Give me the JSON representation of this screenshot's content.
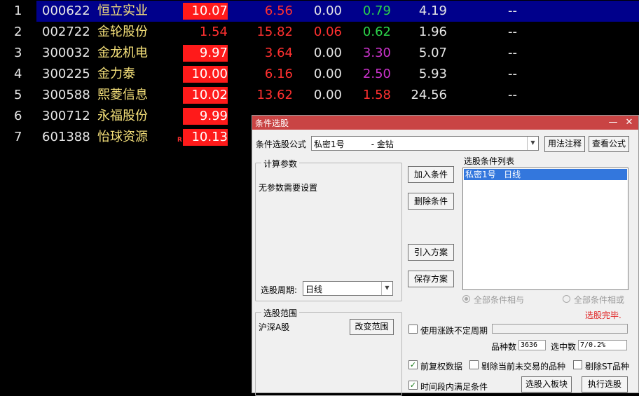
{
  "stocks": [
    {
      "idx": "1",
      "code": "000622",
      "name": "恒立实业",
      "pct": "10.07",
      "price": "6.56",
      "chg": "0.00",
      "turn": "0.79",
      "pe": "4.19",
      "extra": "--",
      "selected": true,
      "pct_red": true,
      "chg_red": false,
      "turn_color": "green"
    },
    {
      "idx": "2",
      "code": "002722",
      "name": "金轮股份",
      "pct": "1.54",
      "price": "15.82",
      "chg": "0.06",
      "turn": "0.62",
      "pe": "1.96",
      "extra": "--",
      "selected": false,
      "pct_red": false,
      "chg_red": true,
      "turn_color": "green"
    },
    {
      "idx": "3",
      "code": "300032",
      "name": "金龙机电",
      "pct": "9.97",
      "price": "3.64",
      "chg": "0.00",
      "turn": "3.30",
      "pe": "5.07",
      "extra": "--",
      "selected": false,
      "pct_red": true,
      "chg_red": false,
      "turn_color": "purple"
    },
    {
      "idx": "4",
      "code": "300225",
      "name": "金力泰",
      "pct": "10.00",
      "price": "6.16",
      "chg": "0.00",
      "turn": "2.50",
      "pe": "5.93",
      "extra": "--",
      "selected": false,
      "pct_red": true,
      "chg_red": false,
      "turn_color": "purple"
    },
    {
      "idx": "5",
      "code": "300588",
      "name": "熙菱信息",
      "pct": "10.02",
      "price": "13.62",
      "chg": "0.00",
      "turn": "1.58",
      "pe": "24.56",
      "extra": "--",
      "selected": false,
      "pct_red": true,
      "chg_red": false,
      "turn_color": "red"
    },
    {
      "idx": "6",
      "code": "300712",
      "name": "永福股份",
      "pct": "9.99",
      "price": "",
      "chg": "",
      "turn": "",
      "pe": "",
      "extra": "",
      "selected": false,
      "pct_red": true,
      "chg_red": false,
      "turn_color": "green"
    },
    {
      "idx": "7",
      "code": "601388",
      "name": "怡球资源",
      "pct": "10.13",
      "price": "",
      "chg": "",
      "turn": "",
      "pe": "",
      "extra": "",
      "selected": false,
      "pct_red": true,
      "chg_red": false,
      "turn_color": "green",
      "flag": "R"
    }
  ],
  "dialog": {
    "title": "条件选股",
    "minimize": "—",
    "close": "✕",
    "formula_label": "条件选股公式",
    "formula_value": "私密1号          - 金钻",
    "usage_button": "用法注释",
    "view_formula_button": "查看公式",
    "params_legend": "计算参数",
    "params_text": "无参数需要设置",
    "period_label": "选股周期:",
    "period_value": "日线",
    "add_condition_button": "加入条件",
    "delete_condition_button": "删除条件",
    "import_plan_button": "引入方案",
    "save_plan_button": "保存方案",
    "conditions_label": "选股条件列表",
    "conditions": [
      "私密1号   日线"
    ],
    "radio_and": "全部条件相与",
    "radio_or": "全部条件相或",
    "status": "选股完毕.",
    "range_legend": "选股范围",
    "range_value": "沪深A股",
    "change_range_button": "改变范围",
    "use_uncertain_period": "使用涨跌不定周期",
    "count_label": "品种数",
    "count_value": "3636",
    "selected_label": "选中数",
    "selected_value": "7/0.2%",
    "adjusted_data": "前复权数据",
    "exclude_untraded": "剔除当前未交易的品种",
    "exclude_st": "剔除ST品种",
    "time_condition": "时间段内满足条件",
    "to_block_button": "选股入板块",
    "execute_button": "执行选股"
  }
}
